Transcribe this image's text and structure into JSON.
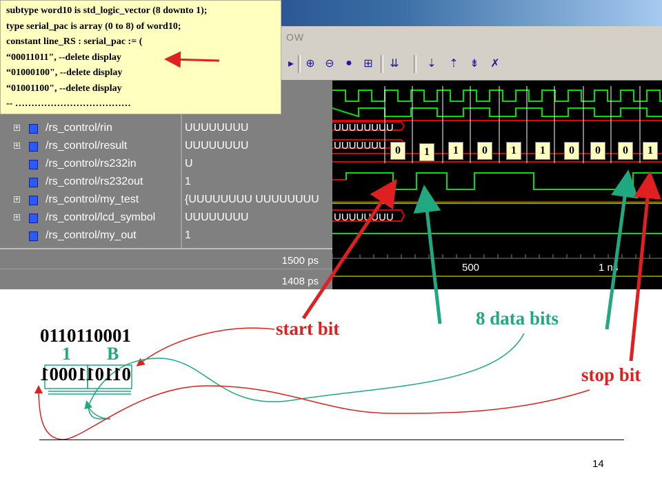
{
  "window": {
    "menu_fragment": "OW"
  },
  "toolbar": {
    "icons": [
      "zoom-in-icon",
      "zoom-out-icon",
      "zoom-full-icon",
      "zoom-area-icon",
      "find-edge-icon",
      "next-edge-icon",
      "prev-edge-icon",
      "delete-edge-icon"
    ]
  },
  "signals": [
    {
      "name": "/rs_control/rin",
      "value": "UUUUUUUU",
      "expandable": true
    },
    {
      "name": "/rs_control/result",
      "value": "UUUUUUUU",
      "expandable": true
    },
    {
      "name": "/rs_control/rs232in",
      "value": "U",
      "expandable": false
    },
    {
      "name": "/rs_control/rs232out",
      "value": "1",
      "expandable": false
    },
    {
      "name": "/rs_control/my_test",
      "value": "{UUUUUUUU UUUUUUUU",
      "expandable": true
    },
    {
      "name": "/rs_control/lcd_symbol",
      "value": "UUUUUUUU",
      "expandable": true
    },
    {
      "name": "/rs_control/my_out",
      "value": "1",
      "expandable": false
    }
  ],
  "wave_labels": {
    "rin": "UUUUUUUU",
    "result": "UUUUUUU",
    "lcd": "UUUUUUUU"
  },
  "time": {
    "now": "1500 ps",
    "cursor": "1408 ps",
    "tick_500": "500",
    "tick_1ns": "1 ns"
  },
  "bits": [
    "0",
    "1",
    "1",
    "0",
    "1",
    "1",
    "0",
    "0",
    "0",
    "1"
  ],
  "code_note": {
    "lines": [
      "subtype word10 is std_logic_vector (8 downto 1);",
      "type serial_pac is  array (0 to 8) of word10;",
      "constant line_RS : serial_pac := (",
      "“00011011\",  --delete display",
      "“01000100\",  --delete display",
      "“01001100\",  --delete display",
      "-- ………………………………"
    ]
  },
  "annotations": {
    "start_bit": "start bit",
    "data_bits": "8 data bits",
    "stop_bit": "stop bit",
    "bits_top": "0110110001",
    "hex_1": "1",
    "hex_b": "B",
    "bits_mirrored": "0110110001"
  },
  "page_number": "14",
  "colors": {
    "red": "#e02020",
    "teal": "#20a880",
    "wave_green": "#00e000",
    "wave_red": "#e00000"
  }
}
